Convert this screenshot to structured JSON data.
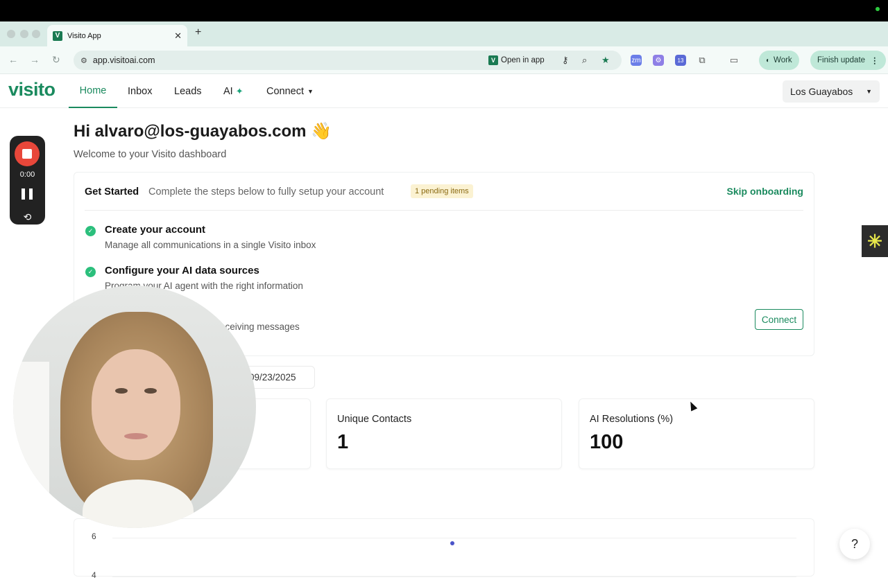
{
  "browser": {
    "tab_title": "Visito App",
    "favicon_letter": "V",
    "url": "app.visitoai.com",
    "open_in_app": "Open in app",
    "extension_badge": "13",
    "profile_label": "Work",
    "update_label": "Finish update"
  },
  "nav": {
    "logo": "visito",
    "items": [
      {
        "label": "Home"
      },
      {
        "label": "Inbox"
      },
      {
        "label": "Leads"
      },
      {
        "label": "AI"
      },
      {
        "label": "Connect"
      }
    ],
    "workspace": "Los Guayabos"
  },
  "main": {
    "greeting": "Hi alvaro@los-guayabos.com 👋",
    "welcome": "Welcome to your Visito dashboard"
  },
  "get_started": {
    "title": "Get Started",
    "subtitle": "Complete the steps below to fully setup your account",
    "badge": "1 pending items",
    "skip": "Skip onboarding",
    "steps": [
      {
        "title": "Create your account",
        "desc": "Manage all communications in a single Visito inbox"
      },
      {
        "title": "Configure your AI data sources",
        "desc": "Program your AI agent with the right information"
      },
      {
        "title": "",
        "desc": "eceiving messages"
      }
    ],
    "connect_button": "Connect"
  },
  "date_range": "09/23/2025",
  "stats": [
    {
      "label": "Unique Contacts",
      "value": "1"
    },
    {
      "label": "AI Resolutions (%)",
      "value": "100"
    }
  ],
  "chart_data": {
    "type": "line",
    "y_ticks": [
      "6",
      "4"
    ],
    "points": [
      {
        "y": 5.7
      }
    ]
  },
  "recorder": {
    "time": "0:00"
  },
  "help": "?",
  "colors": {
    "brand": "#1a8a5e",
    "badge_bg": "#fbf2d2",
    "recorder_stop": "#e8473a"
  }
}
